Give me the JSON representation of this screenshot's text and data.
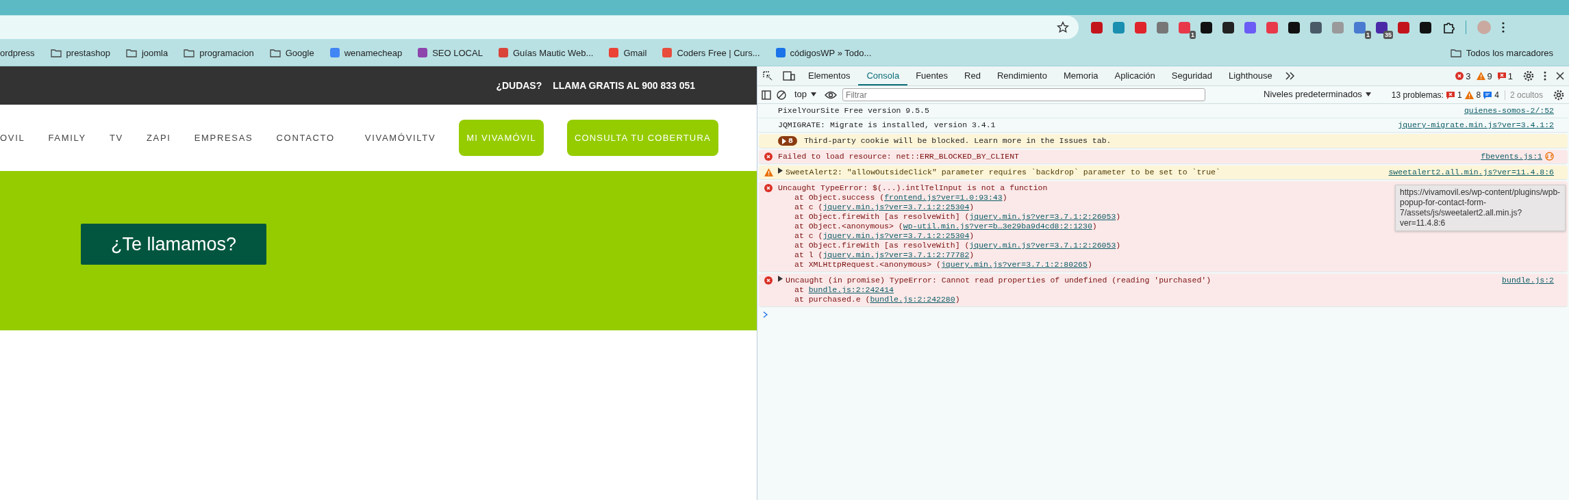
{
  "browser": {
    "extensions": [
      {
        "color": "#c4141b"
      },
      {
        "color": "#1a8fb0"
      },
      {
        "color": "#e0242b"
      },
      {
        "color": "#777777"
      },
      {
        "color": "#e8394a",
        "badge": "1"
      },
      {
        "color": "#111111"
      },
      {
        "color": "#222222"
      },
      {
        "color": "#6b5cf6"
      },
      {
        "color": "#e8394a"
      },
      {
        "color": "#111111"
      },
      {
        "color": "#4a5a66"
      },
      {
        "color": "#9a9a9a"
      },
      {
        "color": "#4a7bd0",
        "badge": "1"
      },
      {
        "color": "#4b2aa8",
        "badge": "35"
      },
      {
        "color": "#c4141b"
      },
      {
        "color": "#111111"
      }
    ],
    "bookmarks": [
      {
        "label": "ordpress",
        "kind": "plain"
      },
      {
        "label": "prestashop",
        "kind": "folder"
      },
      {
        "label": "joomla",
        "kind": "folder"
      },
      {
        "label": "programacion",
        "kind": "folder"
      },
      {
        "label": "Google",
        "kind": "folder"
      },
      {
        "label": "wenamecheap",
        "kind": "site",
        "color": "#4285f4"
      },
      {
        "label": "SEO LOCAL",
        "kind": "site",
        "color": "#8e44ad"
      },
      {
        "label": "Guías Mautic Web...",
        "kind": "site",
        "color": "#d9453a"
      },
      {
        "label": "Gmail",
        "kind": "site",
        "color": "#ea4335"
      },
      {
        "label": "Coders Free | Curs...",
        "kind": "site",
        "color": "#e74c3c"
      },
      {
        "label": "códigosWP » Todo...",
        "kind": "site",
        "color": "#1a73e8"
      }
    ],
    "all_bookmarks": "Todos los marcadores"
  },
  "site": {
    "topbar": [
      "¿DUDAS?",
      "LLAMA GRATIS AL 900 833 051"
    ],
    "nav": [
      {
        "label": "OVIL",
        "kind": "link"
      },
      {
        "label": "FAMILY",
        "kind": "link"
      },
      {
        "label": "TV",
        "kind": "link"
      },
      {
        "label": "ZAPI",
        "kind": "link"
      },
      {
        "label": "EMPRESAS",
        "kind": "link"
      },
      {
        "label": "CONTACTO",
        "kind": "link"
      },
      {
        "label": "VIVAMÓVILTV",
        "kind": "link"
      },
      {
        "label": "MI VIVAMÓVIL",
        "kind": "button"
      },
      {
        "label": "CONSULTA TU COBERTURA",
        "kind": "button"
      }
    ],
    "cta": "¿Te llamamos?"
  },
  "devtools": {
    "tabs": [
      {
        "label": "Elementos",
        "selected": false
      },
      {
        "label": "Consola",
        "selected": true
      },
      {
        "label": "Fuentes",
        "selected": false
      },
      {
        "label": "Red",
        "selected": false
      },
      {
        "label": "Rendimiento",
        "selected": false
      },
      {
        "label": "Memoria",
        "selected": false
      },
      {
        "label": "Aplicación",
        "selected": false
      },
      {
        "label": "Seguridad",
        "selected": false
      },
      {
        "label": "Lighthouse",
        "selected": false
      }
    ],
    "counts": [
      {
        "kind": "error",
        "count": "3"
      },
      {
        "kind": "warning",
        "count": "9"
      },
      {
        "kind": "issue",
        "count": "1"
      }
    ],
    "toolbar": {
      "context": "top",
      "filter_placeholder": "Filtrar",
      "levels": "Niveles predeterminados",
      "problems_label": "13 problemas:",
      "problem_counts": [
        {
          "kind": "issue",
          "count": "1"
        },
        {
          "kind": "warning",
          "count": "8"
        },
        {
          "kind": "info",
          "count": "4"
        }
      ],
      "hidden": "2 ocultos"
    },
    "messages": [
      {
        "kind": "log",
        "collapsible": false,
        "blocked": false,
        "text": "PixelYourSite Free version 9.5.5",
        "source": "quienes-somos-2/:52"
      },
      {
        "kind": "log",
        "collapsible": false,
        "blocked": false,
        "text": "JQMIGRATE: Migrate is installed, version 3.4.1",
        "source": "jquery-migrate.min.js?ver=3.4.1:2"
      },
      {
        "kind": "issue",
        "collapsible": true,
        "blocked": false,
        "badge": "8",
        "text": "Third-party cookie will be blocked. Learn more in the Issues tab."
      },
      {
        "kind": "error",
        "collapsible": false,
        "blocked": true,
        "text": "Failed to load resource: net::ERR_BLOCKED_BY_CLIENT",
        "source": "fbevents.js:1"
      },
      {
        "kind": "warning",
        "collapsible": true,
        "blocked": false,
        "text": "SweetAlert2: \"allowOutsideClick\" parameter requires `backdrop` parameter to be set to `true`",
        "source": "sweetalert2.all.min.js?ver=11.4.8:6"
      },
      {
        "kind": "error",
        "collapsible": false,
        "blocked": false,
        "text": "Uncaught TypeError: $(...).intlTelInput is not a function",
        "frames": [
          {
            "before": "at Object.success (",
            "link": "frontend.js?ver=1.0:93:43",
            "after": ")"
          },
          {
            "before": "at c (",
            "link": "jquery.min.js?ver=3.7.1:2:25304",
            "after": ")"
          },
          {
            "before": "at Object.fireWith [as resolveWith] (",
            "link": "jquery.min.js?ver=3.7.1:2:26053",
            "after": ")"
          },
          {
            "before": "at Object.<anonymous> (",
            "link": "wp-util.min.js?ver=b…3e29ba9d4cd8:2:1230",
            "after": ")"
          },
          {
            "before": "at c (",
            "link": "jquery.min.js?ver=3.7.1:2:25304",
            "after": ")"
          },
          {
            "before": "at Object.fireWith [as resolveWith] (",
            "link": "jquery.min.js?ver=3.7.1:2:26053",
            "after": ")"
          },
          {
            "before": "at l (",
            "link": "jquery.min.js?ver=3.7.1:2:77782",
            "after": ")"
          },
          {
            "before": "at XMLHttpRequest.<anonymous> (",
            "link": "jquery.min.js?ver=3.7.1:2:80265",
            "after": ")"
          }
        ]
      },
      {
        "kind": "error",
        "collapsible": true,
        "blocked": false,
        "text": "Uncaught (in promise) TypeError: Cannot read properties of undefined (reading 'purchased')",
        "source": "bundle.js:2",
        "frames": [
          {
            "before": "at ",
            "link": "bundle.js:2:242414"
          },
          {
            "before": "at purchased.e (",
            "link": "bundle.js:2:242280",
            "after": ")"
          }
        ]
      }
    ],
    "tooltip": "https://vivamovil.es/wp-content/plugins/wpb-popup-for-contact-form-7/assets/js/sweetalert2.all.min.js?ver=11.4.8:6"
  }
}
